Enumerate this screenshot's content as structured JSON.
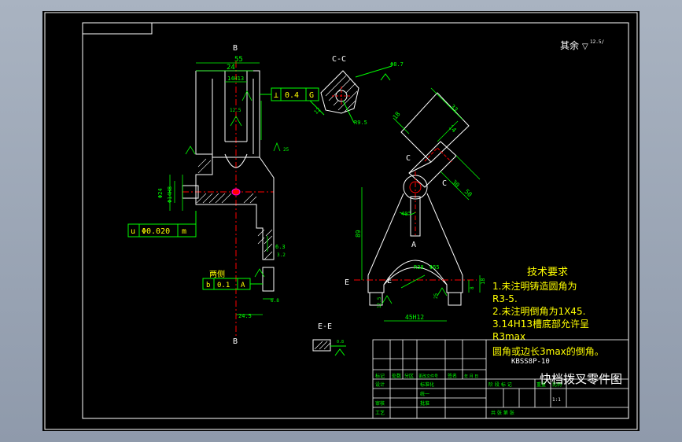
{
  "colors": {
    "background": "#000000",
    "frame": "#ffffff",
    "dimension": "#00ff00",
    "outline": "#ffffff",
    "hidden": "#ff0000",
    "text_yellow": "#ffff00",
    "highlight": "#ff00ff"
  },
  "roughness_note": {
    "label": "其余",
    "symbol": "▽",
    "value": "12.5/"
  },
  "view_b": {
    "top_label": "B",
    "bottom_label": "B",
    "dim_55": "55",
    "dim_24": "24",
    "dim_14h13": "14H13",
    "dim_phi24": "Φ24",
    "dim_phi14h8": "Φ14H8",
    "dim_12_5": "12.5",
    "dim_6_3": "6.3",
    "dim_3_2": "3.2",
    "dim_24_5": "24.5",
    "dim_6_8": "6.8",
    "dim_25": "25",
    "perp_tol": {
      "symbol": "⊥",
      "value": "0.4",
      "datum": "G"
    },
    "cyl_tol": {
      "symbol": "u",
      "value": "Φ0.020",
      "datum": "m"
    },
    "side_tol_label": "两侧",
    "side_tol": {
      "symbol": "b",
      "value": "0.1",
      "datum": "A"
    }
  },
  "section_cc": {
    "title": "C-C",
    "dim_r": "R9.5",
    "dim_phi": "Φ8.7",
    "dim_12": "12"
  },
  "main_view": {
    "label_c1": "C",
    "label_c2": "C",
    "label_a": "A",
    "label_e1": "E",
    "label_e2": "E",
    "dim_33": "33",
    "dim_18": "18",
    "dim_14": "14",
    "dim_50": "50",
    "dim_30": "30",
    "dim_40": "40°",
    "dim_r38": "R38",
    "dim_phi55": "Φ55",
    "dim_45h12": "45H12",
    "dim_12_5": "12.5",
    "dim_8": "8",
    "dim_18b": "18",
    "dim_25": "25",
    "dim_89": "89"
  },
  "section_ee": {
    "title": "E-E",
    "dim": "0.8"
  },
  "tech_requirements": {
    "title": "技术要求",
    "items": [
      "1.未注明铸造圆角为",
      "R3-5.",
      "2.未注明倒角为1X45.",
      "3.14H13槽底部允许呈",
      "R3max",
      "圆角或边长3max的倒角。"
    ]
  },
  "title_block": {
    "part_code": "KBSS8P-10",
    "part_name": "快档拨叉零件图",
    "cells": {
      "marker": "标记",
      "count": "处数",
      "zone": "分区",
      "doc_no": "更改文件号",
      "signature": "签名",
      "date": "年 月 日",
      "design": "设计",
      "standard": "标准化",
      "stage_mark": "阶 段 标 记",
      "weight": "重量",
      "scale": "比例",
      "check": "审核",
      "process": "工艺",
      "approve": "批准",
      "scale_value": "1:1",
      "sheet_total": "共   张  第   张",
      "pct": "统一"
    }
  }
}
